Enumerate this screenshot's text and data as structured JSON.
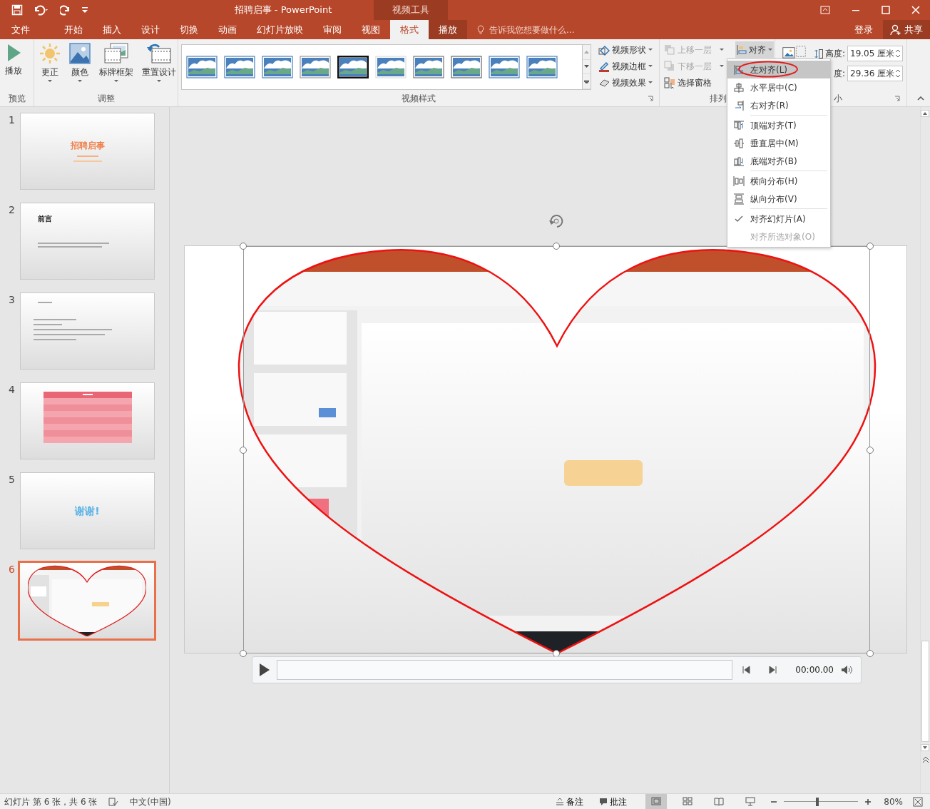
{
  "title_bar": {
    "title": "招聘启事 - PowerPoint",
    "context_group": "视频工具"
  },
  "tabs": [
    {
      "label": "文件",
      "selected": false,
      "contextual": false
    },
    {
      "label": "开始",
      "selected": false,
      "contextual": false
    },
    {
      "label": "插入",
      "selected": false,
      "contextual": false
    },
    {
      "label": "设计",
      "selected": false,
      "contextual": false
    },
    {
      "label": "切换",
      "selected": false,
      "contextual": false
    },
    {
      "label": "动画",
      "selected": false,
      "contextual": false
    },
    {
      "label": "幻灯片放映",
      "selected": false,
      "contextual": false
    },
    {
      "label": "审阅",
      "selected": false,
      "contextual": false
    },
    {
      "label": "视图",
      "selected": false,
      "contextual": false
    },
    {
      "label": "格式",
      "selected": true,
      "contextual": true
    },
    {
      "label": "播放",
      "selected": false,
      "contextual": true
    }
  ],
  "tell_me": {
    "placeholder": "告诉我您想要做什么..."
  },
  "account": {
    "sign_in": "登录",
    "share": "共享"
  },
  "ribbon": {
    "preview": {
      "label": "预览",
      "button": "播放"
    },
    "adjust": {
      "label": "调整",
      "buttons": [
        "更正",
        "颜色",
        "标牌框架",
        "重置设计"
      ]
    },
    "video_styles": {
      "label": "视频样式",
      "commands": [
        "视频形状",
        "视频边框",
        "视频效果"
      ]
    },
    "arrange": {
      "label": "排列",
      "commands": [
        {
          "label": "上移一层",
          "disabled": true
        },
        {
          "label": "下移一层",
          "disabled": true
        },
        {
          "label": "选择窗格",
          "disabled": false
        }
      ],
      "align": {
        "label": "对齐",
        "expanded": true
      }
    },
    "size": {
      "label": "小",
      "height_label": "高度:",
      "height": "19.05 厘米",
      "width_label": "度:",
      "width": "29.36 厘米"
    }
  },
  "align_menu": {
    "sections": [
      [
        {
          "label": "左对齐(L)",
          "selected": true,
          "circled": true,
          "checked": false,
          "disabled": false
        },
        {
          "label": "水平居中(C)",
          "selected": false,
          "circled": false,
          "checked": false,
          "disabled": false
        },
        {
          "label": "右对齐(R)",
          "selected": false,
          "circled": false,
          "checked": false,
          "disabled": false
        }
      ],
      [
        {
          "label": "顶端对齐(T)",
          "selected": false,
          "circled": false,
          "checked": false,
          "disabled": false
        },
        {
          "label": "垂直居中(M)",
          "selected": false,
          "circled": false,
          "checked": false,
          "disabled": false
        },
        {
          "label": "底端对齐(B)",
          "selected": false,
          "circled": false,
          "checked": false,
          "disabled": false
        }
      ],
      [
        {
          "label": "横向分布(H)",
          "selected": false,
          "circled": false,
          "checked": false,
          "disabled": false
        },
        {
          "label": "纵向分布(V)",
          "selected": false,
          "circled": false,
          "checked": false,
          "disabled": false
        }
      ],
      [
        {
          "label": "对齐幻灯片(A)",
          "selected": false,
          "circled": false,
          "checked": true,
          "disabled": false
        },
        {
          "label": "对齐所选对象(O)",
          "selected": false,
          "circled": false,
          "checked": false,
          "disabled": true
        }
      ]
    ]
  },
  "slides": [
    {
      "number": "1",
      "selected": false,
      "kind": "title",
      "title": "招聘启事"
    },
    {
      "number": "2",
      "selected": false,
      "kind": "heading",
      "title": "前言"
    },
    {
      "number": "3",
      "selected": false,
      "kind": "text"
    },
    {
      "number": "4",
      "selected": false,
      "kind": "table"
    },
    {
      "number": "5",
      "selected": false,
      "kind": "thanks",
      "title": "谢谢!"
    },
    {
      "number": "6",
      "selected": true,
      "kind": "video"
    }
  ],
  "video_player": {
    "time": "00:00.00"
  },
  "status_bar": {
    "slide_info": "幻灯片 第 6 张，共 6 张",
    "language": "中文(中国)",
    "notes": "备注",
    "comments": "批注",
    "views": [
      {
        "kind": "normal",
        "selected": true
      },
      {
        "kind": "sorter",
        "selected": false
      },
      {
        "kind": "reading",
        "selected": false
      },
      {
        "kind": "slideshow",
        "selected": false
      }
    ],
    "zoom": {
      "level": 0.45,
      "percent": "80%"
    }
  }
}
